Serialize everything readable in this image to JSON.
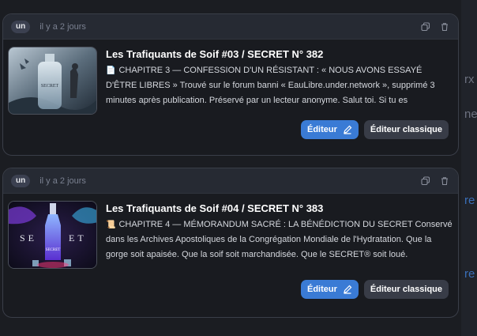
{
  "background": {
    "glyphs": [
      "rx",
      "ne",
      "re",
      "re"
    ]
  },
  "cards": [
    {
      "user": "un",
      "time": "il y a 2 jours",
      "title": "Les Trafiquants de Soif #03 / SECRET N° 382",
      "doc_icon": "📄",
      "description": "CHAPITRE 3 — CONFESSION D'UN RÉSISTANT : « NOUS AVONS ESSAYÉ D'ÊTRE LIBRES » Trouvé sur le forum banni « EauLibre.under.network », supprimé 3 minutes après publication. Préservé par un lecteur anonyme. Salut toi. Si tu es",
      "thumb_label": "SECRET",
      "editor_label": "Éditeur",
      "classic_label": "Éditeur classique"
    },
    {
      "user": "un",
      "time": "il y a 2 jours",
      "title": "Les Trafiquants de Soif #04 / SECRET N° 383",
      "doc_icon": "📜",
      "description": "CHAPITRE 4 — MÉMORANDUM SACRÉ : LA BÉNÉDICTION DU SECRET Conservé dans les Archives Apostoliques de la Congrégation Mondiale de l'Hydratation. Que la gorge soit apaisée. Que la soif soit marchandisée. Que le SECRET® soit loué.",
      "thumb_label": "SECRET",
      "editor_label": "Éditeur",
      "classic_label": "Éditeur classique"
    }
  ],
  "colors": {
    "accent": "#3a7bd5",
    "card_bg": "#191b20",
    "header_bg": "#262a33"
  },
  "icons": [
    "copy-icon",
    "trash-icon",
    "pencil-icon"
  ]
}
